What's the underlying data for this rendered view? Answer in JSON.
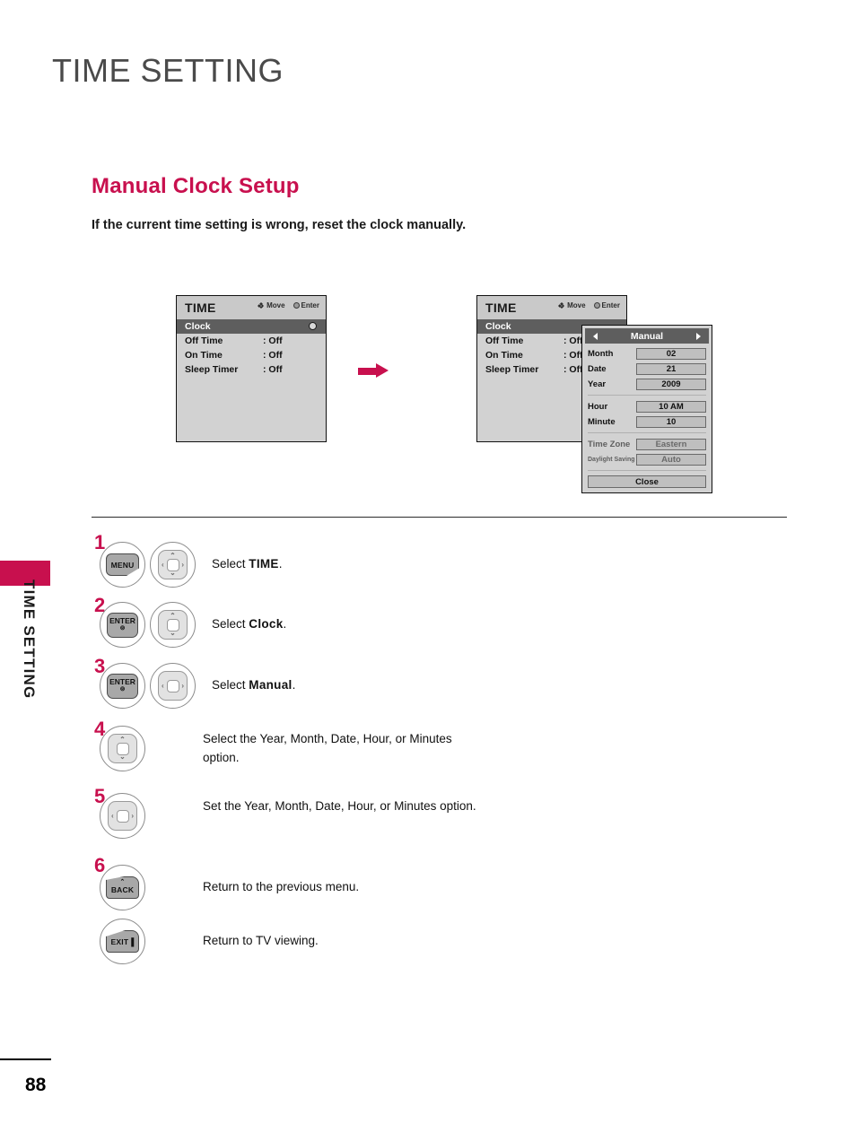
{
  "page": {
    "title": "TIME SETTING",
    "number": "88",
    "side_tab_label": "TIME SETTING",
    "accent_color": "#c8104e"
  },
  "section": {
    "heading": "Manual Clock Setup",
    "subheading": "If the current time setting is wrong, reset the clock manually."
  },
  "osd_menu": {
    "title": "TIME",
    "hint_move": "Move",
    "hint_enter": "Enter",
    "rows": [
      {
        "label": "Clock",
        "value": "",
        "selected": true
      },
      {
        "label": "Off Time",
        "value": ": Off",
        "selected": false
      },
      {
        "label": "On Time",
        "value": ": Off",
        "selected": false
      },
      {
        "label": "Sleep Timer",
        "value": ": Off",
        "selected": false
      }
    ]
  },
  "manual_dialog": {
    "title": "Manual",
    "fields": [
      {
        "label": "Month",
        "value": "02",
        "dim": false
      },
      {
        "label": "Date",
        "value": "21",
        "dim": false
      },
      {
        "label": "Year",
        "value": "2009",
        "dim": false
      },
      {
        "label": "Hour",
        "value": "10 AM",
        "dim": false
      },
      {
        "label": "Minute",
        "value": "10",
        "dim": false
      },
      {
        "label": "Time Zone",
        "value": "Eastern",
        "dim": true
      },
      {
        "label": "Daylight Saving",
        "value": "Auto",
        "dim": true
      }
    ],
    "close_label": "Close"
  },
  "steps": [
    {
      "num": "1",
      "keys": [
        "MENU",
        "pad-4way"
      ],
      "text_prefix": "Select ",
      "text_emph": "TIME",
      "text_suffix": "."
    },
    {
      "num": "2",
      "keys": [
        "ENTER",
        "pad-updown"
      ],
      "text_prefix": "Select ",
      "text_emph": "Clock",
      "text_suffix": "."
    },
    {
      "num": "3",
      "keys": [
        "ENTER",
        "pad-leftright"
      ],
      "text_prefix": "Select ",
      "text_emph": "Manual",
      "text_suffix": "."
    },
    {
      "num": "4",
      "keys": [
        "pad-updown"
      ],
      "text_full": "Select the Year, Month, Date, Hour, or Minutes option."
    },
    {
      "num": "5",
      "keys": [
        "pad-leftright"
      ],
      "text_full": "Set the Year, Month, Date, Hour, or Minutes option."
    },
    {
      "num": "6",
      "keys": [
        "BACK"
      ],
      "text_full": "Return to the previous menu."
    },
    {
      "num": "",
      "keys": [
        "EXIT"
      ],
      "text_full": "Return to TV viewing."
    }
  ],
  "key_labels": {
    "menu": "MENU",
    "enter": "ENTER",
    "enter_dot": "⊚",
    "back": "BACK",
    "back_arrow": "⌃",
    "exit": "EXIT",
    "exit_bar": "▐",
    "chevron_up": "⌃",
    "chevron_down": "⌄",
    "chevron_left": "‹",
    "chevron_right": "›"
  }
}
